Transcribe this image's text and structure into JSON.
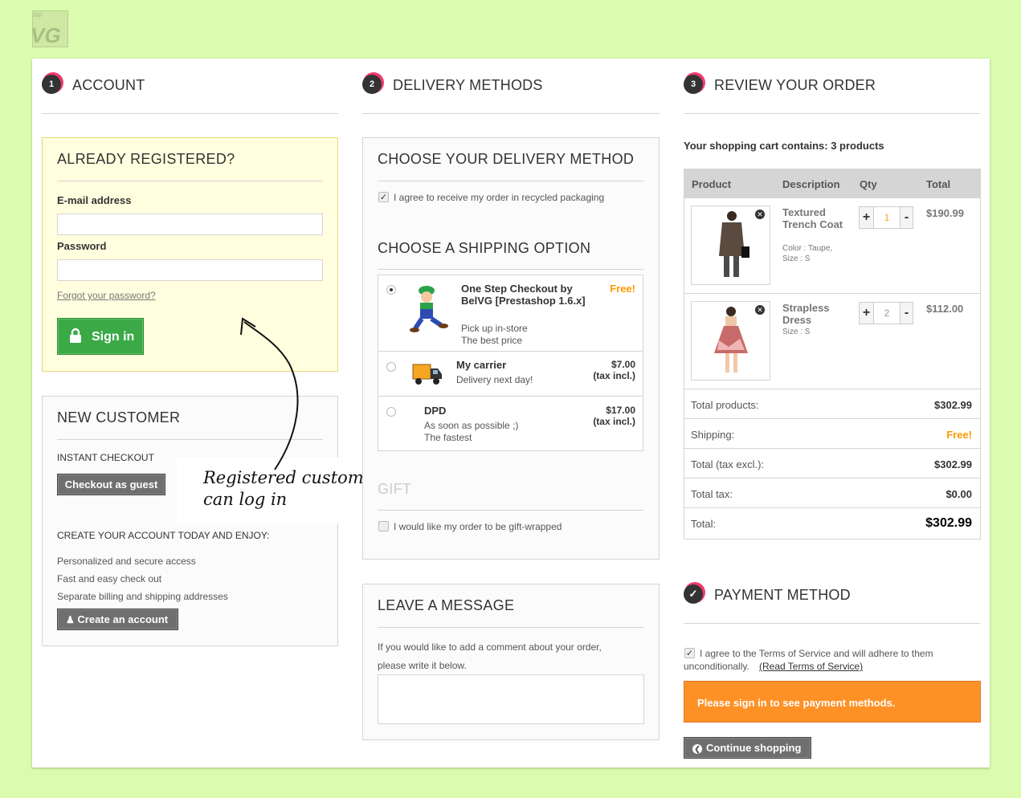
{
  "logo": {
    "text": "bel VG"
  },
  "steps": {
    "account": {
      "num": "1",
      "title": "ACCOUNT"
    },
    "delivery": {
      "num": "2",
      "title": "DELIVERY METHODS"
    },
    "review": {
      "num": "3",
      "title": "REVIEW YOUR ORDER"
    },
    "payment": {
      "num": "✓",
      "title": "PAYMENT METHOD"
    }
  },
  "login": {
    "title": "ALREADY REGISTERED?",
    "email_label": "E-mail address",
    "email_value": "",
    "password_label": "Password",
    "password_value": "",
    "forgot": "Forgot your password?",
    "sign_in": "Sign in"
  },
  "new_customer": {
    "title": "NEW CUSTOMER",
    "instant": "INSTANT CHECKOUT",
    "guest_button": "Checkout as guest",
    "create_heading": "CREATE YOUR ACCOUNT TODAY AND ENJOY:",
    "benefits": [
      "Personalized and secure access",
      "Fast and easy check out",
      "Separate billing and shipping addresses"
    ],
    "create_button": "Create an account"
  },
  "annotation": {
    "line1": "Registered customer",
    "line2": "can log in"
  },
  "delivery": {
    "title": "CHOOSE YOUR DELIVERY METHOD",
    "recycled_label": "I agree to receive my order in recycled packaging",
    "recycled_checked": true,
    "shipping_title": "CHOOSE A SHIPPING OPTION",
    "options": [
      {
        "name": "One Step Checkout by BelVG [Prestashop 1.6.x]",
        "line1": "Pick up in-store",
        "line2": "The best price",
        "price": "Free!",
        "tax": "",
        "selected": true
      },
      {
        "name": "My carrier",
        "line1": "Delivery next day!",
        "line2": "",
        "price": "$7.00",
        "tax": "(tax incl.)",
        "selected": false
      },
      {
        "name": "DPD",
        "line1": "As soon as possible ;)",
        "line2": "The fastest",
        "price": "$17.00",
        "tax": "(tax incl.)",
        "selected": false
      }
    ],
    "gift_title": "GIFT",
    "gift_label": "I would like my order to be gift-wrapped"
  },
  "message": {
    "title": "LEAVE A MESSAGE",
    "hint1": "If you would like to add a comment about your order,",
    "hint2": "please write it below.",
    "value": ""
  },
  "cart": {
    "summary": "Your shopping cart contains: 3 products",
    "headers": {
      "product": "Product",
      "description": "Description",
      "qty": "Qty",
      "total": "Total"
    },
    "items": [
      {
        "name": "Textured Trench Coat",
        "attr1": "Color : Taupe,",
        "attr2": "Size : S",
        "qty": "1",
        "total": "$190.99",
        "plus": "+",
        "minus": "-"
      },
      {
        "name": "Strapless Dress",
        "attr1": "Size : S",
        "attr2": "",
        "qty": "2",
        "total": "$112.00",
        "plus": "+",
        "minus": "-"
      }
    ],
    "totals": [
      {
        "label": "Total products:",
        "value": "$302.99"
      },
      {
        "label": "Shipping:",
        "value": "Free!"
      },
      {
        "label": "Total (tax excl.):",
        "value": "$302.99"
      },
      {
        "label": "Total tax:",
        "value": "$0.00"
      },
      {
        "label": "Total:",
        "value": "$302.99"
      }
    ]
  },
  "payment": {
    "terms_text": "I agree to the Terms of Service and will adhere to them",
    "terms_text2": "unconditionally.",
    "terms_link": "(Read Terms of Service)",
    "terms_checked": true,
    "notice": "Please sign in to see payment methods.",
    "continue": "Continue shopping"
  },
  "colors": {
    "accent": "#f13b6d",
    "free": "#ff9900",
    "signin": "#3aa946",
    "notice": "#fe9126"
  }
}
